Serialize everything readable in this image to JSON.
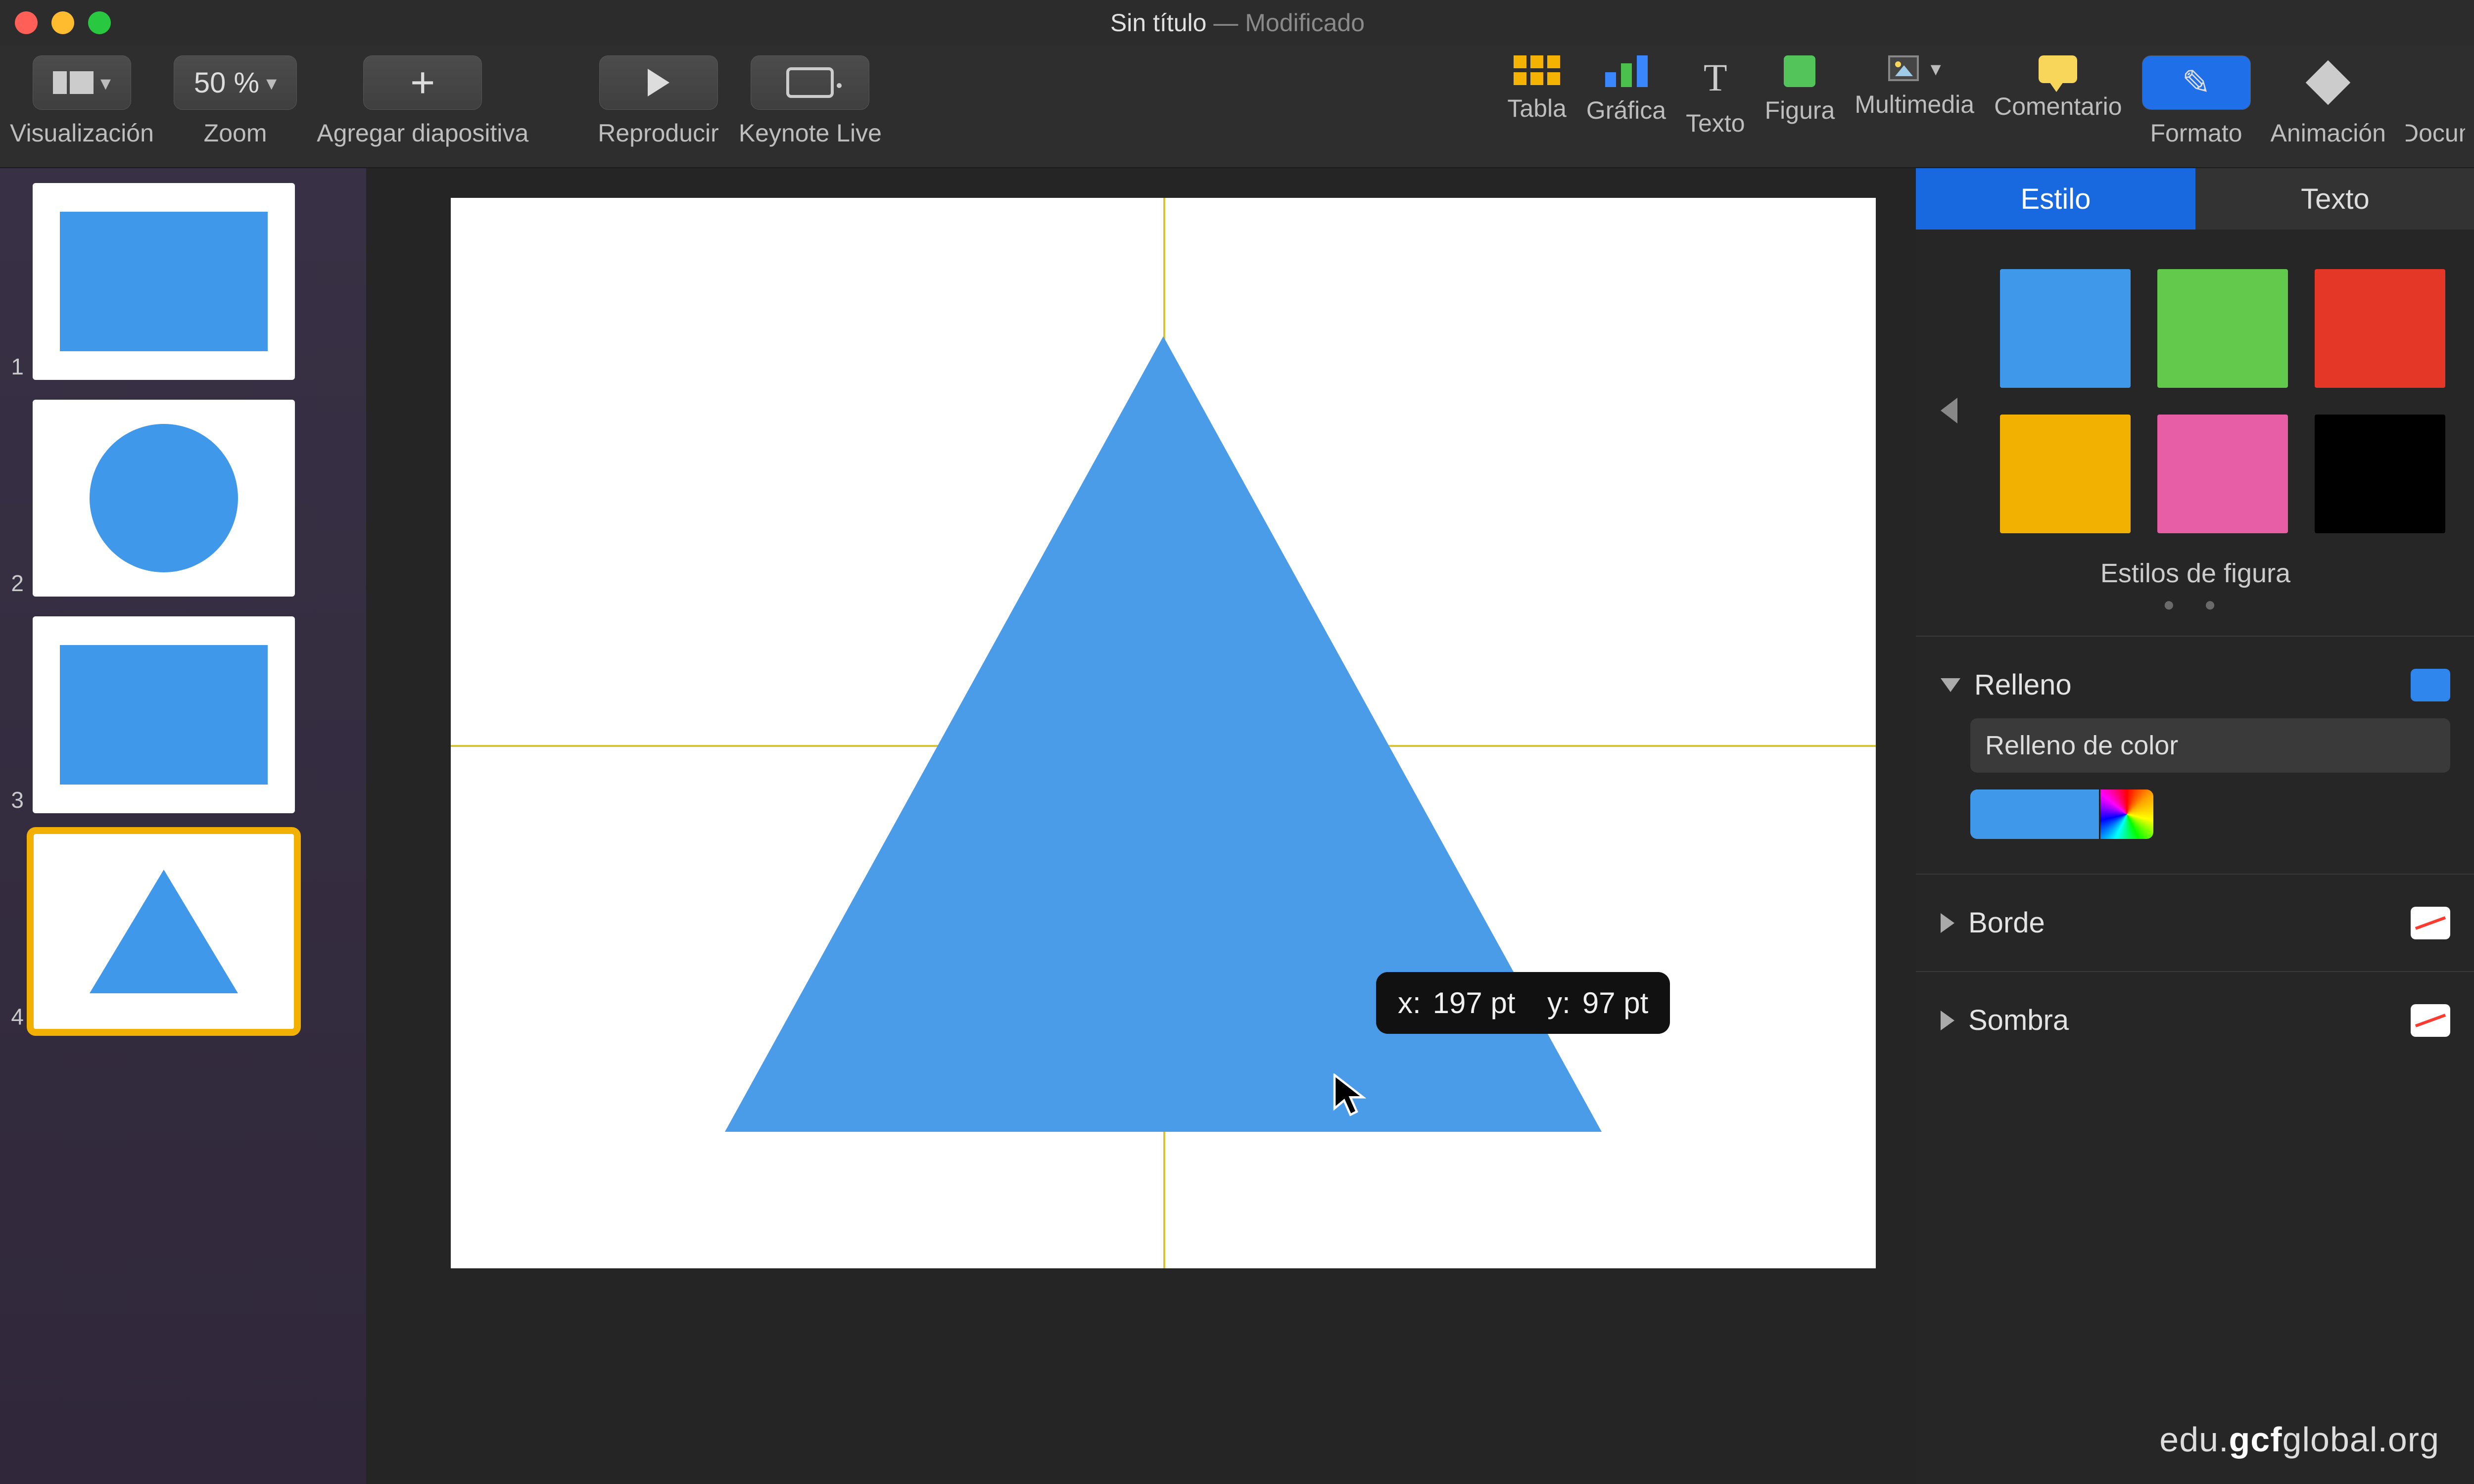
{
  "window": {
    "title_name": "Sin título",
    "title_sep": " — ",
    "title_state": "Modificado"
  },
  "toolbar": {
    "view": "Visualización",
    "zoom_value": "50 %",
    "zoom": "Zoom",
    "add_slide": "Agregar diapositiva",
    "play": "Reproducir",
    "keynote_live": "Keynote Live",
    "table": "Tabla",
    "chart": "Gráfica",
    "text": "Texto",
    "shape": "Figura",
    "media": "Multimedia",
    "comment": "Comentario",
    "format": "Formato",
    "animate": "Animación",
    "document": "Document"
  },
  "nav": {
    "n1": "1",
    "n2": "2",
    "n3": "3",
    "n4": "4"
  },
  "canvas": {
    "tooltip_x_label": "x:",
    "tooltip_x_value": "197 pt",
    "tooltip_y_label": "y:",
    "tooltip_y_value": "97 pt"
  },
  "inspector": {
    "tab_style": "Estilo",
    "tab_text": "Texto",
    "styles_title": "Estilos de figura",
    "swatches": [
      "#3f98ea",
      "#63c94c",
      "#e53727",
      "#f2b100",
      "#e75da6",
      "#000000"
    ],
    "fill": "Relleno",
    "fill_type": "Relleno de color",
    "fill_color": "#3f98ea",
    "border": "Borde",
    "shadow": "Sombra"
  },
  "watermark": {
    "pre": "edu.",
    "mid": "gcf",
    "post": "global.org"
  }
}
